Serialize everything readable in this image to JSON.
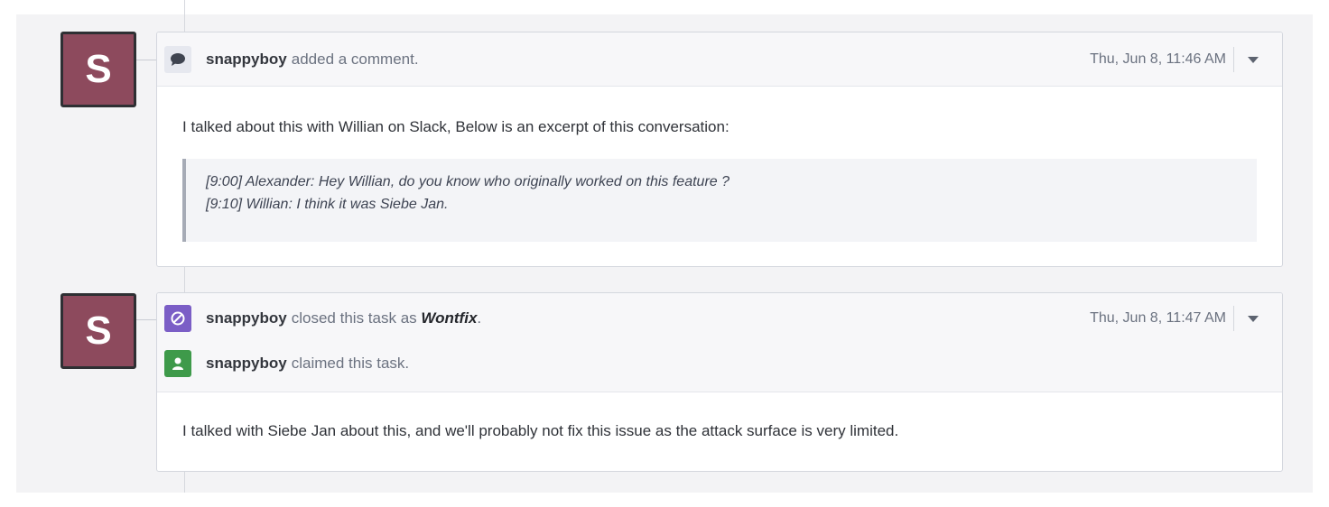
{
  "events": [
    {
      "avatar_letter": "S",
      "header_lines": [
        {
          "icon": "comment-icon",
          "user": "snappyboy",
          "action": "added a comment.",
          "emphasis": ""
        }
      ],
      "timestamp": "Thu, Jun 8, 11:46 AM",
      "body": "I talked about this with Willian on Slack, Below is an excerpt of this conversation:",
      "quote_lines": [
        "[9:00] Alexander: Hey Willian, do you know who originally worked on this feature ?",
        "[9:10] Willian: I think it was Siebe Jan."
      ]
    },
    {
      "avatar_letter": "S",
      "header_lines": [
        {
          "icon": "ban-icon",
          "user": "snappyboy",
          "action": "closed this task as",
          "emphasis": "Wontfix",
          "suffix": "."
        },
        {
          "icon": "user-icon",
          "user": "snappyboy",
          "action": "claimed this task.",
          "emphasis": ""
        }
      ],
      "timestamp": "Thu, Jun 8, 11:47 AM",
      "body": "I talked with Siebe Jan about this, and we'll probably not fix this issue as the attack surface is very limited."
    }
  ],
  "colors": {
    "avatar": "#8d4a5d",
    "close_badge": "#7b5ec6",
    "claim_badge": "#3e9a4a"
  }
}
